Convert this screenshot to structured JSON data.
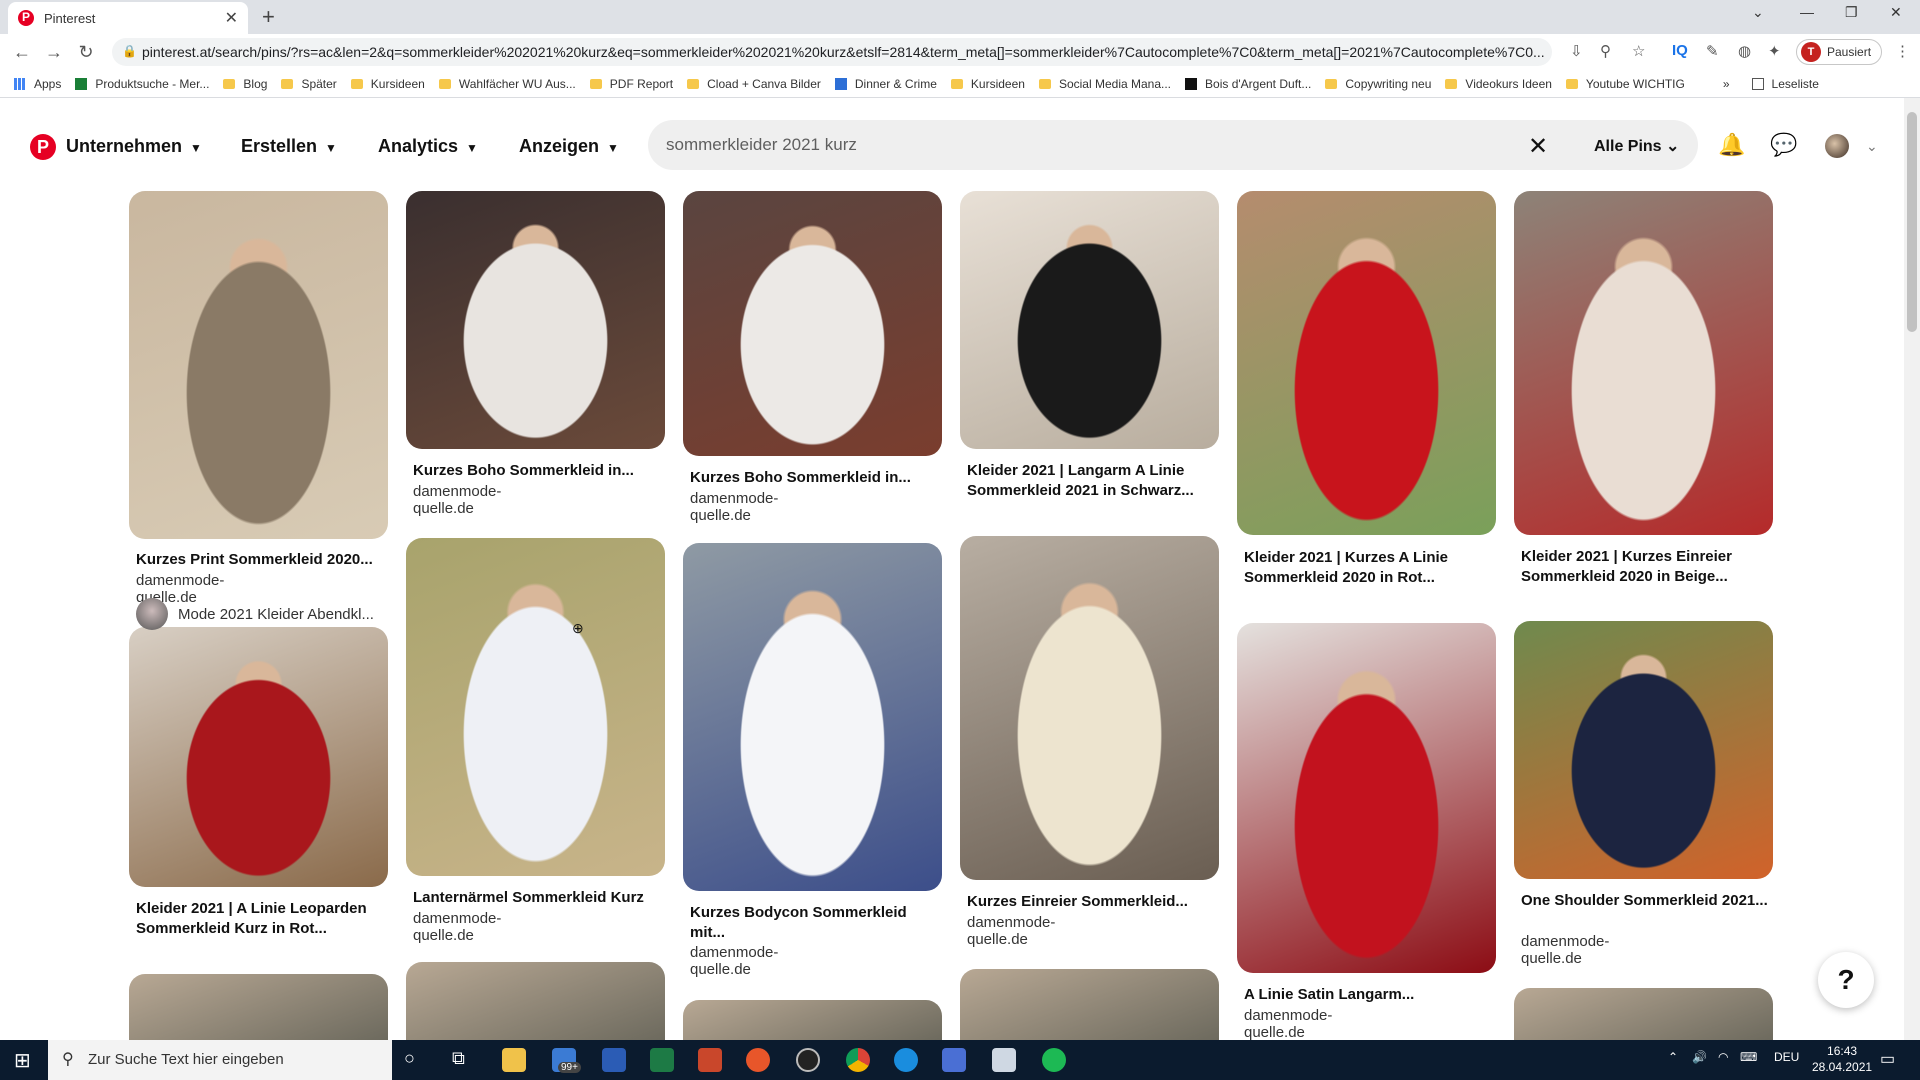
{
  "browser": {
    "tab_title": "Pinterest",
    "new_tab": "+",
    "url": "pinterest.at/search/pins/?rs=ac&len=2&q=sommerkleider%202021%20kurz&eq=sommerkleider%202021%20kurz&etslf=2814&term_meta[]=sommerkleider%7Cautocomplete%7C0&term_meta[]=2021%7Cautocomplete%7C0...",
    "profile_initial": "T",
    "profile_status": "Pausiert",
    "reading_list": "Leseliste",
    "bookmarks": [
      "Apps",
      "Produktsuche - Mer...",
      "Blog",
      "Später",
      "Kursideen",
      "Wahlfächer WU Aus...",
      "PDF Report",
      "Cload + Canva Bilder",
      "Dinner & Crime",
      "Kursideen",
      "Social Media Mana...",
      "Bois d'Argent Duft...",
      "Copywriting neu",
      "Videokurs Ideen",
      "Youtube WICHTIG"
    ]
  },
  "pinterest": {
    "logo": "P",
    "menu": [
      "Unternehmen",
      "Erstellen",
      "Analytics",
      "Anzeigen"
    ],
    "search_value": "sommerkleider 2021 kurz",
    "filter_label": "Alle Pins",
    "help_label": "?",
    "pins": [
      {
        "title": "Kurzes Print Sommerkleid 2020...",
        "source": "damenmode-quelle.de",
        "colors": [
          "#c9b79f",
          "#8a7a66",
          "#d8cbb5"
        ]
      },
      {
        "title": "Kurzes Boho Sommerkleid in...",
        "source": "damenmode-quelle.de",
        "colors": [
          "#3a2f2f",
          "#e8e4e0",
          "#6b4a3a"
        ]
      },
      {
        "title": "Kurzes Boho Sommerkleid in...",
        "source": "damenmode-quelle.de",
        "colors": [
          "#5a4540",
          "#ece9e6",
          "#7a3d2e"
        ]
      },
      {
        "title": "Kleider 2021 | Langarm A Linie Sommerkleid 2021 in Schwarz...",
        "source": "",
        "colors": [
          "#e8e0d6",
          "#1a1a1a",
          "#b8ad9e"
        ]
      },
      {
        "title": "Kleider 2021 | Kurzes A Linie Sommerkleid 2020 in Rot...",
        "source": "",
        "colors": [
          "#b58c6e",
          "#c8141c",
          "#7aa05a"
        ]
      },
      {
        "title": "Kleider 2021 | Kurzes Einreier Sommerkleid 2020 in Beige...",
        "source": "",
        "colors": [
          "#8d8378",
          "#e9ddd3",
          "#b52a2a"
        ]
      },
      {
        "title": "Kleider 2021 | A Linie Leoparden Sommerkleid Kurz in Rot...",
        "source": "",
        "colors": [
          "#d8cfc4",
          "#a9171c",
          "#8a6a4a"
        ]
      },
      {
        "title": "Lanternärmel Sommerkleid Kurz",
        "source": "damenmode-quelle.de",
        "colors": [
          "#a8a36c",
          "#eef0f5",
          "#c8b48a"
        ]
      },
      {
        "title": "Kurzes Bodycon Sommerkleid mit...",
        "source": "damenmode-quelle.de",
        "colors": [
          "#8f9aa4",
          "#f4f5f8",
          "#3c4e8a"
        ]
      },
      {
        "title": "Kurzes Einreier Sommerkleid...",
        "source": "damenmode-quelle.de",
        "colors": [
          "#b8aea2",
          "#ede4cf",
          "#6a5e52"
        ]
      },
      {
        "title": "A Linie Satin Langarm...",
        "source": "damenmode-quelle.de",
        "colors": [
          "#e4e1de",
          "#c2121e",
          "#8c0c14"
        ]
      },
      {
        "title": "One Shoulder Sommerkleid 2021...",
        "source": "damenmode-quelle.de",
        "colors": [
          "#6f8a4e",
          "#1c2440",
          "#d1622a"
        ]
      }
    ],
    "board_chip": "Mode 2021 Kleider Abendkl..."
  },
  "taskbar": {
    "search_placeholder": "Zur Suche Text hier eingeben",
    "badge": "99+",
    "lang": "DEU",
    "time": "16:43",
    "date": "28.04.2021"
  }
}
